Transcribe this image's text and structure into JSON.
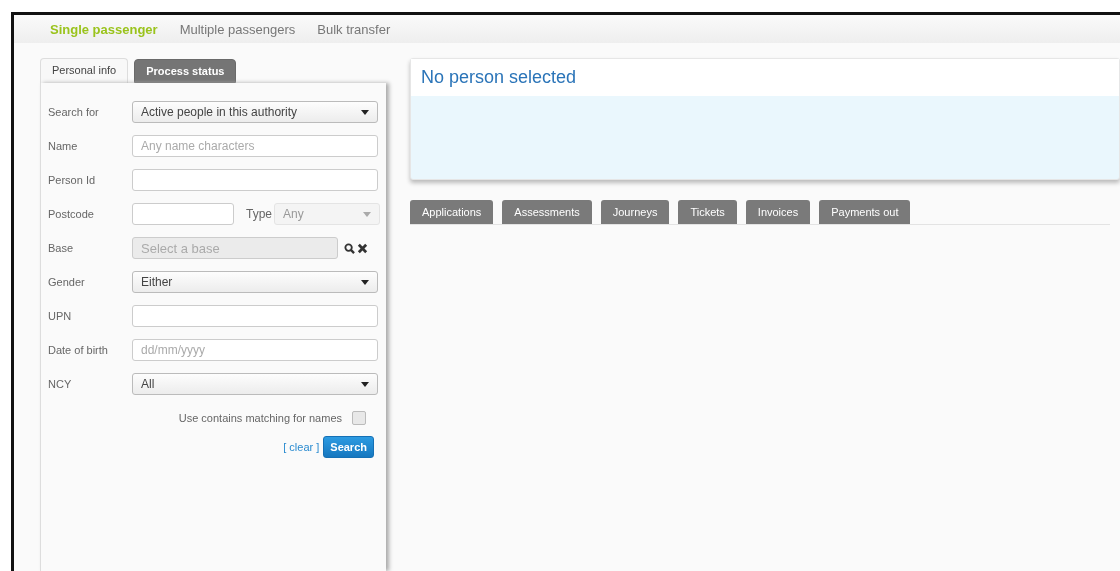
{
  "nav": [
    {
      "label": "Single passenger",
      "selected": true
    },
    {
      "label": "Multiple passengers",
      "selected": false
    },
    {
      "label": "Bulk transfer",
      "selected": false
    }
  ],
  "left_tabs": [
    {
      "label": "Personal info",
      "selected": true
    },
    {
      "label": "Process status",
      "selected": false
    }
  ],
  "form": [
    {
      "kind": "select",
      "label": "Search for",
      "value": "Active people in this authority"
    },
    {
      "kind": "text",
      "label": "Name",
      "placeholder": "Any name characters"
    },
    {
      "kind": "text",
      "label": "Person Id"
    },
    {
      "kind": "postcode",
      "label": "Postcode",
      "type_label": "Type",
      "type_value": "Any",
      "type_disabled": true
    },
    {
      "kind": "picker",
      "label": "Base",
      "placeholder": "Select a base"
    },
    {
      "kind": "select",
      "label": "Gender",
      "value": "Either"
    },
    {
      "kind": "text",
      "label": "UPN"
    },
    {
      "kind": "text",
      "label": "Date of birth",
      "placeholder": "dd/mm/yyyy"
    },
    {
      "kind": "select",
      "label": "NCY",
      "value": "All"
    }
  ],
  "contains_matching": {
    "label": "Use contains matching for names",
    "checked": false
  },
  "clear_link": "[ clear ]",
  "search_button": "Search",
  "person_card": {
    "title": "No person selected"
  },
  "detail_tabs": [
    {
      "label": "Applications",
      "selected": false
    },
    {
      "label": "Assessments",
      "selected": false
    },
    {
      "label": "Journeys",
      "selected": false
    },
    {
      "label": "Tickets",
      "selected": false
    },
    {
      "label": "Invoices",
      "selected": false
    },
    {
      "label": "Payments out",
      "selected": false
    }
  ]
}
